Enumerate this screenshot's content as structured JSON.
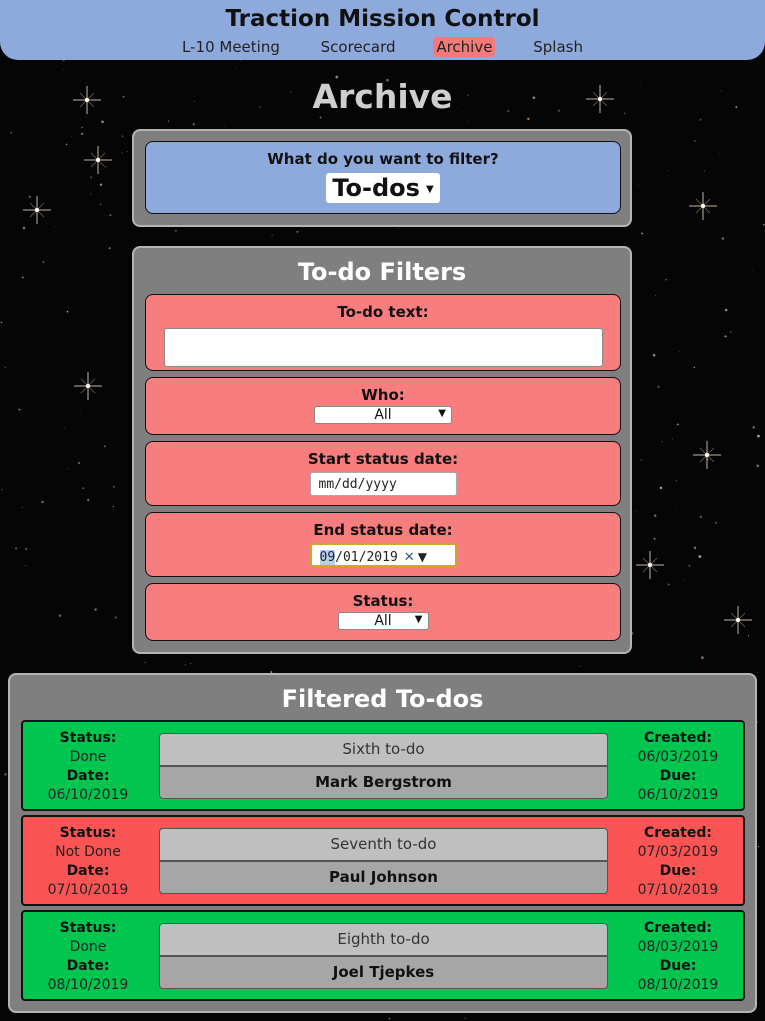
{
  "header": {
    "title": "Traction Mission Control",
    "nav": [
      {
        "label": "L-10 Meeting",
        "active": false
      },
      {
        "label": "Scorecard",
        "active": false
      },
      {
        "label": "Archive",
        "active": true
      },
      {
        "label": "Splash",
        "active": false
      }
    ]
  },
  "page_title": "Archive",
  "filter_type": {
    "question": "What do you want to filter?",
    "selected": "To-dos"
  },
  "filters": {
    "title": "To-do Filters",
    "todo_text": {
      "label": "To-do text:",
      "value": ""
    },
    "who": {
      "label": "Who:",
      "selected": "All"
    },
    "start_date": {
      "label": "Start status date:",
      "placeholder": "mm/dd/yyyy"
    },
    "end_date": {
      "label": "End status date:",
      "month": "09",
      "rest": "/01/2019"
    },
    "status": {
      "label": "Status:",
      "selected": "All"
    }
  },
  "results": {
    "title": "Filtered To-dos",
    "labels": {
      "status": "Status:",
      "date": "Date:",
      "created": "Created:",
      "due": "Due:"
    },
    "todos": [
      {
        "status": "Done",
        "date": "06/10/2019",
        "text": "Sixth to-do",
        "who": "Mark Bergstrom",
        "created": "06/03/2019",
        "due": "06/10/2019",
        "color": "#00c650"
      },
      {
        "status": "Not Done",
        "date": "07/10/2019",
        "text": "Seventh to-do",
        "who": "Paul Johnson",
        "created": "07/03/2019",
        "due": "07/10/2019",
        "color": "#fb5454"
      },
      {
        "status": "Done",
        "date": "08/10/2019",
        "text": "Eighth to-do",
        "who": "Joel Tjepkes",
        "created": "08/03/2019",
        "due": "08/10/2019",
        "color": "#00c650"
      }
    ]
  },
  "colors": {
    "header": "#8ea9dc",
    "panel": "#7f7f7f",
    "filter_box": "#f77d7e",
    "active_nav": "#f47a7a"
  },
  "icons": {
    "select_arrow": "triangle-down-icon",
    "date_clear": "close-icon"
  }
}
